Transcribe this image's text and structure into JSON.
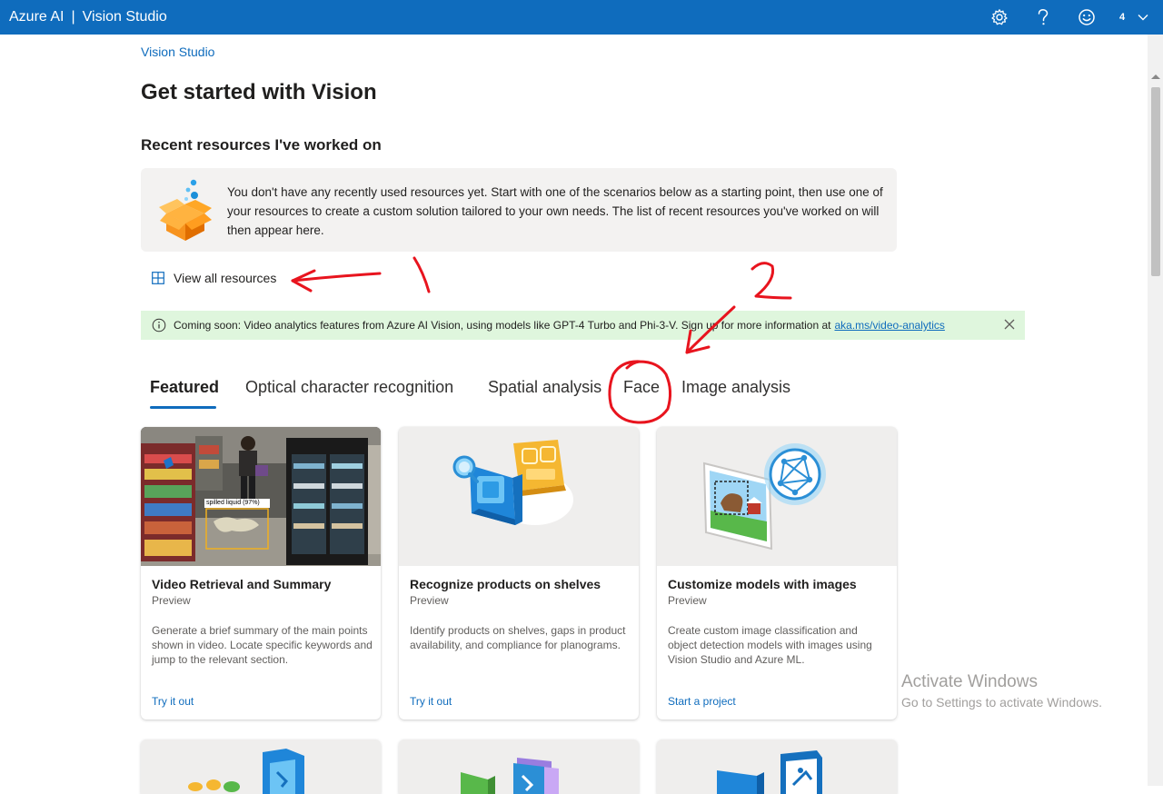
{
  "header": {
    "brand": "Azure AI",
    "separator": "|",
    "product": "Vision Studio",
    "settings_icon": "gear-icon",
    "help_icon": "question-icon",
    "feedback_icon": "smiley-icon",
    "account_label": "4",
    "account_chevron": "chevron-down-icon",
    "color": "#0f6cbd"
  },
  "breadcrumb": "Vision Studio",
  "page_title": "Get started with Vision",
  "recent": {
    "title": "Recent resources I've worked on",
    "empty_message": "You don't have any recently used resources yet. Start with one of the scenarios below as a starting point, then use one of your resources to create a custom solution tailored to your own needs. The list of recent resources you've worked on will then appear here.",
    "icon": "open-box-icon",
    "view_all_label": "View all resources",
    "view_all_icon": "grid-icon"
  },
  "banner": {
    "message": "Coming soon: Video analytics features from Azure AI Vision, using models like GPT-4 Turbo and Phi-3-V. Sign up for more information at",
    "link": "aka.ms/video-analytics",
    "icon": "info-icon",
    "close_icon": "close-icon",
    "color": "#dff6dd"
  },
  "tabs": [
    {
      "label": "Featured",
      "active": true
    },
    {
      "label": "Optical character recognition",
      "active": false
    },
    {
      "label": "Spatial analysis",
      "active": false
    },
    {
      "label": "Face",
      "active": false
    },
    {
      "label": "Image analysis",
      "active": false
    }
  ],
  "cards": [
    {
      "title": "Video Retrieval and Summary",
      "tag": "Preview",
      "description": "Generate a brief summary of the main points shown in video. Locate specific keywords and jump to the relevant section.",
      "action": "Try it out",
      "media_label": "spilled liquid (97%)"
    },
    {
      "title": "Recognize products on shelves",
      "tag": "Preview",
      "description": "Identify products on shelves, gaps in product availability, and compliance for planograms.",
      "action": "Try it out"
    },
    {
      "title": "Customize models with images",
      "tag": "Preview",
      "description": "Create custom image classification and object detection models with images using Vision Studio and Azure ML.",
      "action": "Start a project"
    }
  ],
  "annotations": {
    "label_1": "1",
    "label_2": "2",
    "color": "#e8141e"
  },
  "watermark": {
    "title": "Activate Windows",
    "subtitle": "Go to Settings to activate Windows."
  }
}
